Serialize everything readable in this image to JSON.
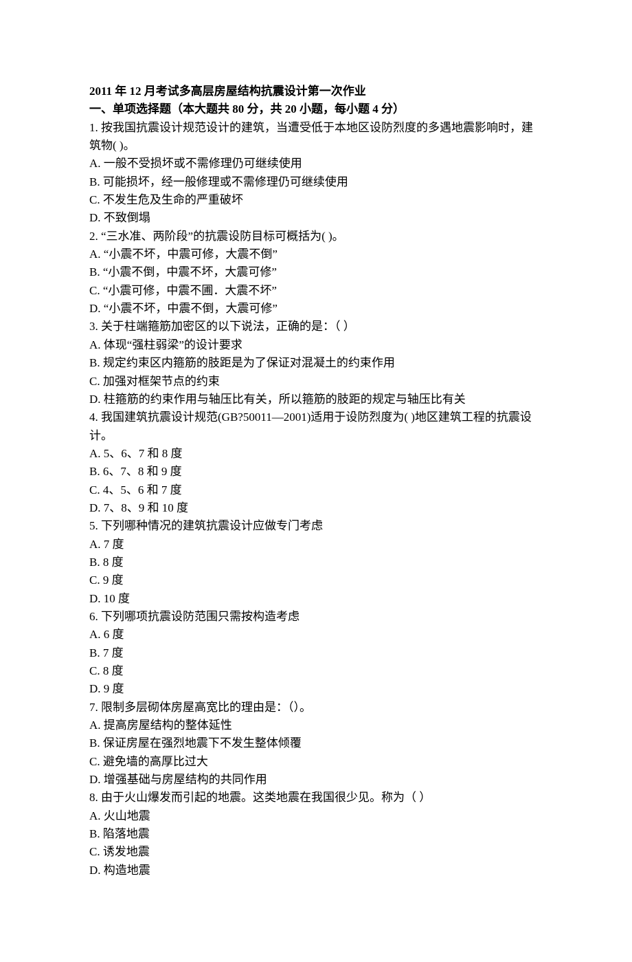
{
  "title": "2011 年 12 月考试多高层房屋结构抗震设计第一次作业",
  "section1_header": "一、单项选择题（本大题共 80 分，共 20 小题，每小题 4 分）",
  "questions": [
    {
      "stem": "1. 按我国抗震设计规范设计的建筑，当遭受低于本地区设防烈度的多遇地震影响时，建筑物( )。",
      "options": [
        "A. 一般不受损坏或不需修理仍可继续使用",
        "B. 可能损坏，经一般修理或不需修理仍可继续使用",
        "C. 不发生危及生命的严重破坏",
        "D. 不致倒塌"
      ]
    },
    {
      "stem": "2. “三水准、两阶段”的抗震设防目标可概括为( )。",
      "options": [
        "A. “小震不坏，中震可修，大震不倒”",
        "B. “小震不倒，中震不坏，大震可修”",
        "C. “小震可修，中震不圃．大震不坏”",
        "D. “小震不坏，中震不倒，大震可修”"
      ]
    },
    {
      "stem": "3. 关于柱端箍筋加密区的以下说法，正确的是：（ ）",
      "options": [
        "A. 体现“强柱弱梁”的设计要求",
        "B. 规定约束区内箍筋的肢距是为了保证对混凝土的约束作用",
        "C. 加强对框架节点的约束",
        "D. 柱箍筋的约束作用与轴压比有关，所以箍筋的肢距的规定与轴压比有关"
      ]
    },
    {
      "stem": "4. 我国建筑抗震设计规范(GB?50011—2001)适用于设防烈度为( )地区建筑工程的抗震设计。",
      "options": [
        "A. 5、6、7 和 8 度",
        "B. 6、7、8 和 9 度",
        "C. 4、5、6 和 7 度",
        "D. 7、8、9 和 10 度"
      ]
    },
    {
      "stem": "5. 下列哪种情况的建筑抗震设计应做专门考虑",
      "options": [
        "A. 7 度",
        "B. 8 度",
        "C. 9 度",
        "D. 10 度"
      ]
    },
    {
      "stem": "6. 下列哪项抗震设防范围只需按构造考虑",
      "options": [
        "A. 6 度",
        "B. 7 度",
        "C. 8 度",
        "D. 9 度"
      ]
    },
    {
      "stem": "7. 限制多层砌体房屋高宽比的理由是：（）。",
      "options": [
        "A. 提高房屋结构的整体延性",
        "B. 保证房屋在强烈地震下不发生整体倾覆",
        "C. 避免墙的高厚比过大",
        "D. 增强基础与房屋结构的共同作用"
      ]
    },
    {
      "stem": "8. 由于火山爆发而引起的地震。这类地震在我国很少见。称为（ ）",
      "options": [
        "A. 火山地震",
        "B. 陷落地震",
        "C. 诱发地震",
        "D. 构造地震"
      ]
    }
  ]
}
